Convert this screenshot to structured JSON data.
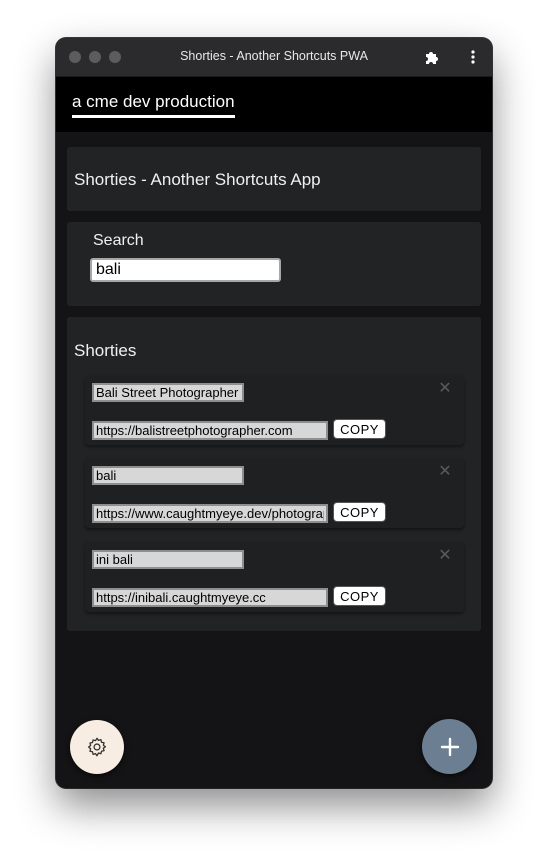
{
  "window": {
    "title": "Shorties - Another Shortcuts PWA"
  },
  "icons": {
    "extensions": "puzzle-icon",
    "menu": "more-vertical-icon",
    "delete": "close-icon",
    "settings": "gear-icon",
    "add": "plus-icon"
  },
  "header": {
    "brand": "a cme dev production"
  },
  "app_card": {
    "title": "Shorties - Another Shortcuts App"
  },
  "search": {
    "label": "Search",
    "value": "bali"
  },
  "shorties": {
    "title": "Shorties",
    "copy_label": "COPY",
    "items": [
      {
        "name": "Bali Street Photographer",
        "url": "https://balistreetphotographer.com"
      },
      {
        "name": "bali",
        "url": "https://www.caughtmyeye.dev/photography"
      },
      {
        "name": "ini bali",
        "url": "https://inibali.caughtmyeye.cc"
      }
    ]
  },
  "colors": {
    "background": "#141416",
    "card": "#222325",
    "settings_fab": "#f8ede2",
    "add_fab": "#6b7e92"
  }
}
